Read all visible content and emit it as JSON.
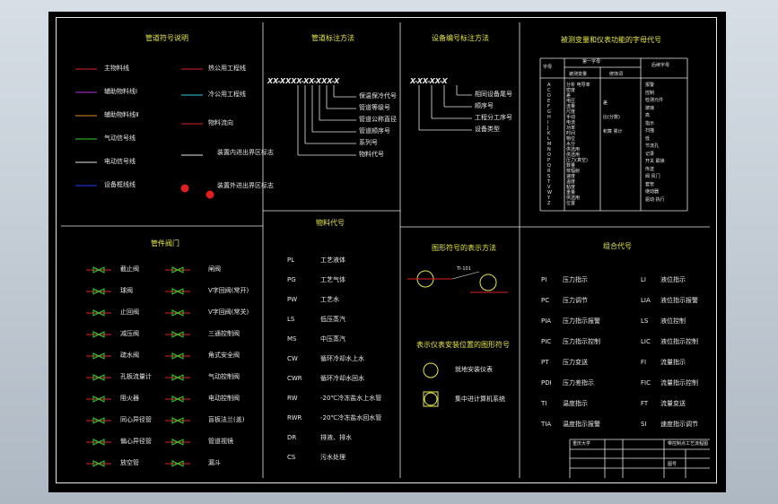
{
  "colors": {
    "background": "#000000",
    "line_white": "#e6e6e6",
    "line_red": "#e02020",
    "line_green": "#30d030",
    "line_purple": "#b030e0",
    "line_cyan": "#30c8e0",
    "line_orange": "#e09020",
    "line_blue": "#2040ff",
    "text_yellow": "#e8e84a"
  },
  "legend": {
    "title": "管道符号说明",
    "items": [
      "主物料线",
      "辅助物料线Ⅰ",
      "辅助物料线Ⅱ",
      "气动信号线",
      "电动信号线",
      "设备框线线",
      "热公用工程线",
      "冷公用工程线",
      "物料流向",
      "装置内进出界区标志",
      "装置外进出界区标志"
    ]
  },
  "pipe_label": {
    "title": "管道标注方法",
    "code": "XX-XXXX-XX-XXX-X",
    "parts": [
      "保温保冷代号",
      "管道等级号",
      "管道公称直径",
      "管道顺序号",
      "系列号",
      "物料代号"
    ]
  },
  "equip_label": {
    "title": "设备编号标注方法",
    "code": "X-XX-XX-X",
    "parts": [
      "相同设备尾号",
      "顺序号",
      "工程分工序号",
      "设备类型"
    ]
  },
  "valves": {
    "title": "管件阀门",
    "items": [
      "截止阀",
      "球阀",
      "止回阀",
      "减压阀",
      "疏水阀",
      "孔板流量计",
      "阻火器",
      "同心异径管",
      "偏心异径管",
      "放空管",
      "闸阀",
      "V字回阀(常开)",
      "V字回阀(常关)",
      "三通控制阀",
      "角式安全阀",
      "气动控制阀",
      "电动控制阀",
      "盲板法兰(盖)",
      "管道视镜",
      "漏斗"
    ]
  },
  "materials": {
    "title": "物料代号",
    "codes": [
      "PL",
      "PG",
      "PW",
      "LS",
      "MS",
      "CW",
      "CWR",
      "RW",
      "RWR",
      "DR",
      "CS"
    ],
    "names": [
      "工艺液体",
      "工艺气体",
      "工艺水",
      "低压蒸汽",
      "中压蒸汽",
      "循环冷却水上水",
      "循环冷却水回水",
      "-20℃冷冻盐水上水管",
      "-20℃冷冻盐水回水管",
      "排液、排水",
      "污水处理"
    ]
  },
  "instrument_method": {
    "title": "图形符号的表示方法",
    "tag": "TI-101"
  },
  "instrument_place": {
    "title": "表示仪表安装位置的图形符号",
    "items": [
      "就地安装仪表",
      "集中进计算机系统"
    ]
  },
  "letters": {
    "title": "被测变量和仪表功能的字母代号",
    "headers": [
      "字母",
      "第一字母",
      "后续字母"
    ],
    "sub_headers": [
      "被测变量",
      "修饰词"
    ],
    "letters_col": [
      "A",
      "C",
      "D",
      "E",
      "F",
      "G",
      "H",
      "I",
      "J",
      "K",
      "L",
      "M",
      "N",
      "O",
      "P",
      "Q",
      "R",
      "S",
      "T",
      "V",
      "W",
      "Y",
      "Z"
    ],
    "first": [
      "分析 电导率",
      "密度",
      "差",
      "电压",
      "流量",
      "尺度",
      "手动",
      "电流",
      "功率",
      "时间",
      "物位",
      "水分",
      "供选用",
      "供选用",
      "压力(真空)",
      "数量",
      "核辐射",
      "速度",
      "温度",
      "粘度",
      "重量",
      "供选用",
      "位置"
    ],
    "modifier": [
      "差",
      "比(分数)",
      "积算 累计"
    ],
    "succeeding": [
      "报警",
      "控制",
      "检测元件",
      "玻璃",
      "高",
      "指示",
      "扫描",
      "低",
      "节流孔",
      "记录",
      "开关 联锁",
      "传送",
      "阀 风门",
      "套管",
      "继动器",
      "驱动 执行"
    ]
  },
  "combos": {
    "title": "组合代号",
    "left_codes": [
      "PI",
      "PC",
      "PIA",
      "PIC",
      "PT",
      "PDI",
      "TI",
      "TIA"
    ],
    "left_names": [
      "压力指示",
      "压力调节",
      "压力指示报警",
      "压力指示控制",
      "压力变送",
      "压力差指示",
      "温度指示",
      "温度指示报警"
    ],
    "right_codes": [
      "LI",
      "LIA",
      "LS",
      "LIC",
      "FI",
      "FIC",
      "FT",
      "SI"
    ],
    "right_names": [
      "液位指示",
      "液位指示报警",
      "液位控制",
      "液位指示控制",
      "流量指示",
      "流量指示控制",
      "流量变送",
      "速度指示调节"
    ]
  },
  "title_block": {
    "school": "重庆大学",
    "drawing_name": "带控制点工艺流程图",
    "drawing_no": "图号"
  }
}
